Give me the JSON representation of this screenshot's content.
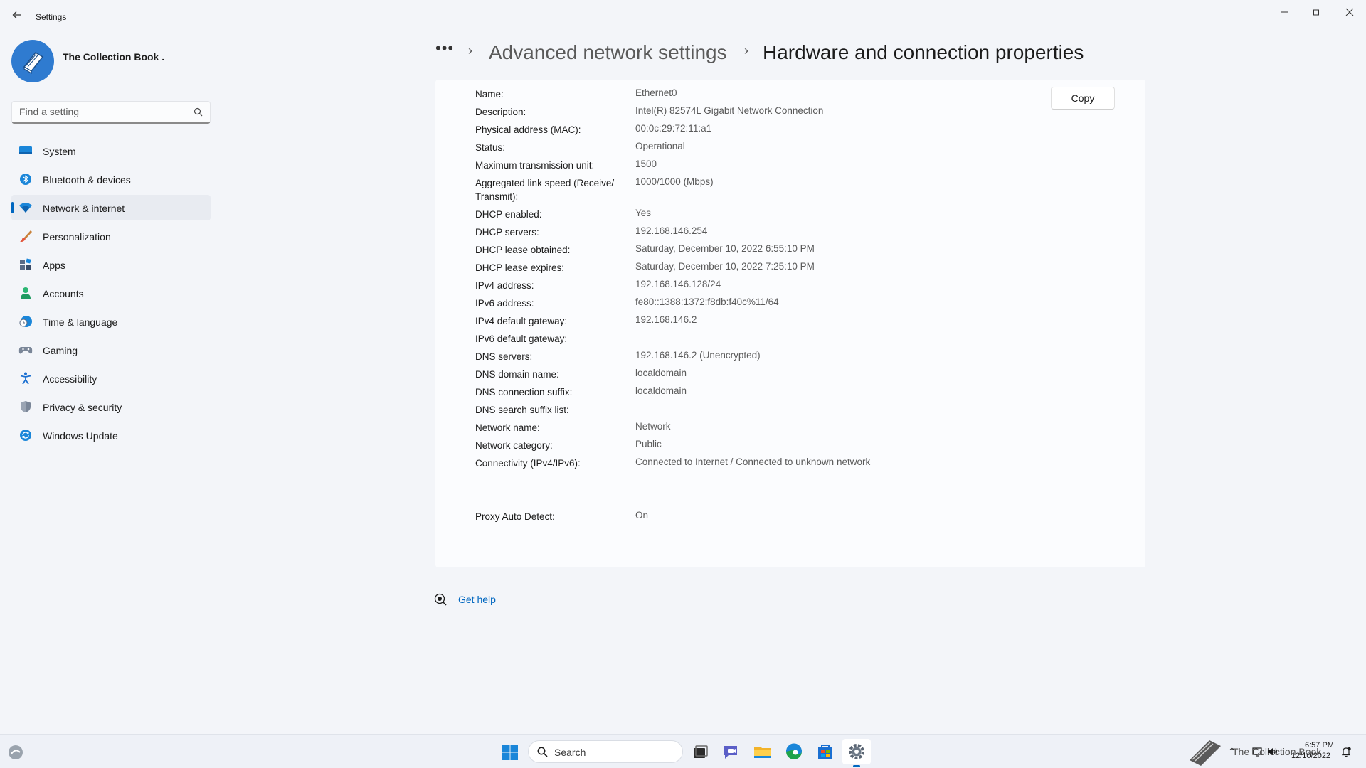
{
  "window": {
    "title": "Settings",
    "back_icon": "back-arrow-icon",
    "minimize": "—",
    "maximize": "❐",
    "close": "✕"
  },
  "profile": {
    "name": "The Collection Book ."
  },
  "search": {
    "placeholder": "Find a setting"
  },
  "sidebar": {
    "items": [
      {
        "label": "System",
        "icon": "system-icon"
      },
      {
        "label": "Bluetooth & devices",
        "icon": "bluetooth-icon"
      },
      {
        "label": "Network & internet",
        "icon": "wifi-icon",
        "active": true
      },
      {
        "label": "Personalization",
        "icon": "brush-icon"
      },
      {
        "label": "Apps",
        "icon": "apps-icon"
      },
      {
        "label": "Accounts",
        "icon": "person-icon"
      },
      {
        "label": "Time & language",
        "icon": "clock-globe-icon"
      },
      {
        "label": "Gaming",
        "icon": "gamepad-icon"
      },
      {
        "label": "Accessibility",
        "icon": "accessibility-icon"
      },
      {
        "label": "Privacy & security",
        "icon": "shield-icon"
      },
      {
        "label": "Windows Update",
        "icon": "update-icon"
      }
    ]
  },
  "breadcrumb": {
    "more": "•••",
    "sep": "›",
    "parent": "Advanced network settings",
    "current": "Hardware and connection properties"
  },
  "properties": {
    "copy_label": "Copy",
    "rows": [
      {
        "label": "Name:",
        "value": "Ethernet0"
      },
      {
        "label": "Description:",
        "value": "Intel(R) 82574L Gigabit Network Connection"
      },
      {
        "label": "Physical address (MAC):",
        "value": "00:0c:29:72:11:a1"
      },
      {
        "label": "Status:",
        "value": "Operational"
      },
      {
        "label": "Maximum transmission unit:",
        "value": "1500"
      },
      {
        "label": "Aggregated link speed (Receive/ Transmit):",
        "value": "1000/1000 (Mbps)"
      },
      {
        "label": "DHCP enabled:",
        "value": "Yes"
      },
      {
        "label": "DHCP servers:",
        "value": "192.168.146.254"
      },
      {
        "label": "DHCP lease obtained:",
        "value": "Saturday, December 10, 2022 6:55:10 PM"
      },
      {
        "label": "DHCP lease expires:",
        "value": "Saturday, December 10, 2022 7:25:10 PM"
      },
      {
        "label": "IPv4 address:",
        "value": "192.168.146.128/24"
      },
      {
        "label": "IPv6 address:",
        "value": "fe80::1388:1372:f8db:f40c%11/64"
      },
      {
        "label": "IPv4 default gateway:",
        "value": "192.168.146.2"
      },
      {
        "label": "IPv6 default gateway:",
        "value": ""
      },
      {
        "label": "DNS servers:",
        "value": "192.168.146.2 (Unencrypted)"
      },
      {
        "label": "DNS domain name:",
        "value": "localdomain"
      },
      {
        "label": "DNS connection suffix:",
        "value": "localdomain"
      },
      {
        "label": "DNS search suffix list:",
        "value": ""
      },
      {
        "label": "Network name:",
        "value": "Network"
      },
      {
        "label": "Network category:",
        "value": "Public"
      },
      {
        "label": "Connectivity (IPv4/IPv6):",
        "value": "Connected to Internet / Connected to unknown network"
      }
    ],
    "proxy": {
      "label": "Proxy Auto Detect:",
      "value": "On"
    }
  },
  "help": {
    "label": "Get help"
  },
  "taskbar": {
    "search_label": "Search",
    "tray_watermark": "The Collection Book",
    "time": "6:57 PM",
    "date": "12/10/2022",
    "tray_icons": "⌃"
  },
  "colors": {
    "accent": "#0067c0",
    "background": "#f3f5f9",
    "card": "#fbfcfe"
  }
}
